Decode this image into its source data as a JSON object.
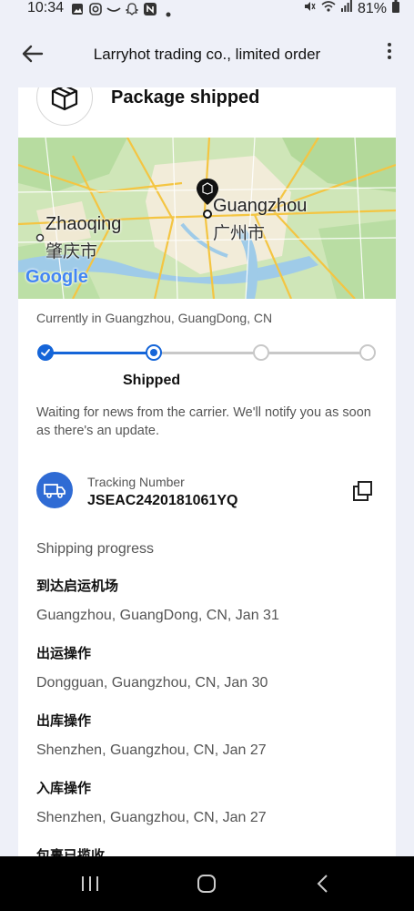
{
  "status_bar": {
    "time": "10:34",
    "battery": "81%",
    "left_icons": [
      "image-icon",
      "instagram-icon",
      "wave-icon",
      "snapchat-icon",
      "app-n-icon",
      "dot-icon"
    ],
    "right_icons": [
      "mute-icon",
      "wifi-icon",
      "signal-icon",
      "battery-icon"
    ]
  },
  "app_bar": {
    "title": "Larryhot trading co., limited order",
    "back_icon": "arrow-left-icon",
    "menu_icon": "more-vertical-icon"
  },
  "package": {
    "title": "Package shipped",
    "icon": "package-icon"
  },
  "map": {
    "city1": "Zhaoqing",
    "city1_cn": "肇庆市",
    "city2": "Guangzhou",
    "city2_cn": "广州市",
    "brand": "Google"
  },
  "current_location": "Currently in Guangzhou, GuangDong, CN",
  "progress": {
    "steps": 4,
    "current_step": 2,
    "current_label": "Shipped",
    "active_color": "#1565d8",
    "inactive_color": "#c8c8c8"
  },
  "waiting_text": "Waiting for news from the carrier. We'll notify you as soon as there's an update.",
  "tracking": {
    "label": "Tracking Number",
    "number": "JSEAC2420181061YQ",
    "icon": "truck-icon",
    "copy_icon": "copy-icon"
  },
  "shipping_progress": {
    "title": "Shipping progress",
    "events": [
      {
        "title": "到达启运机场",
        "detail": "Guangzhou, GuangDong, CN, Jan 31"
      },
      {
        "title": "出运操作",
        "detail": "Dongguan, Guangzhou, CN, Jan 30"
      },
      {
        "title": "出库操作",
        "detail": "Shenzhen, Guangzhou, CN, Jan 27"
      },
      {
        "title": "入库操作",
        "detail": "Shenzhen, Guangzhou, CN, Jan 27"
      },
      {
        "title": "包裹已揽收",
        "detail": ""
      }
    ]
  },
  "nav_bar": {
    "recent_icon": "recent-apps-icon",
    "home_icon": "home-icon",
    "back_icon": "back-chevron-icon"
  }
}
